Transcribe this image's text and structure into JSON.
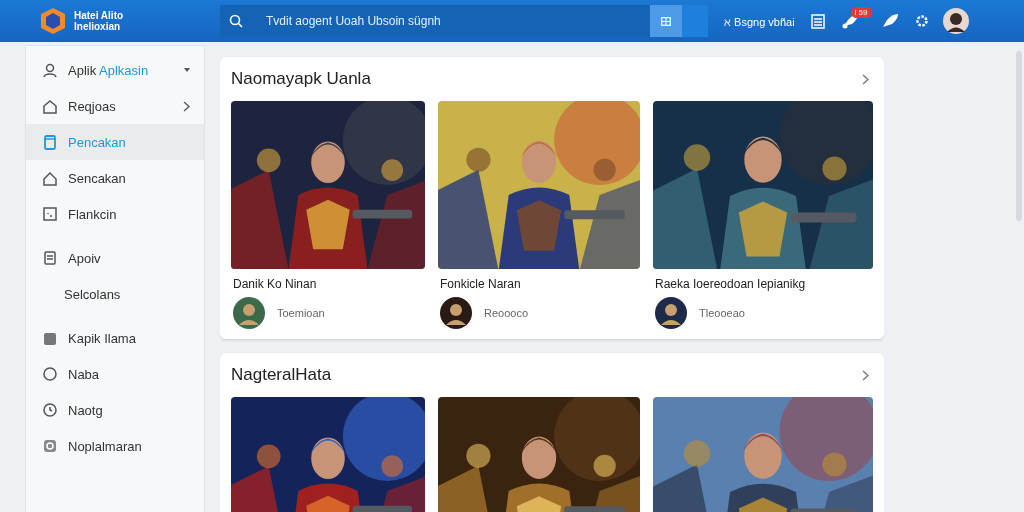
{
  "topbar": {
    "brand": [
      "Hatei Alito",
      "Inelioxian"
    ],
    "search": {
      "placeholder": "Tvdit aogent Uoah Ubsoin sügnh"
    },
    "account_label": "ℵ Bsgng vbñai",
    "badge": "i 59"
  },
  "sidebar": {
    "items": [
      {
        "kind": "header",
        "label": "Aplik",
        "accent": "Aplkasin",
        "selected": false
      },
      {
        "kind": "group",
        "label": "Reqjoas",
        "selected": false
      },
      {
        "kind": "link",
        "label": "Pencakan",
        "selected": true
      },
      {
        "kind": "link",
        "label": "Sencakan",
        "selected": false
      },
      {
        "kind": "link",
        "label": "Flankcin",
        "selected": false
      },
      {
        "kind": "link",
        "label": "Apoiv",
        "selected": false
      },
      {
        "kind": "sub",
        "label": "Selcolans",
        "selected": false
      },
      {
        "kind": "link",
        "label": "Kapik Ilama",
        "selected": false
      },
      {
        "kind": "link",
        "label": "Naba",
        "selected": false
      },
      {
        "kind": "link",
        "label": "Naotg",
        "selected": false
      },
      {
        "kind": "link",
        "label": "Noplalmaran",
        "selected": false
      }
    ]
  },
  "sections": [
    {
      "title": "Naomayapk Uanla",
      "cards": [
        {
          "kind": "game",
          "title": "Danik Ko Ninan",
          "subtitle": "Toemioan"
        },
        {
          "kind": "game",
          "title": "Fonkicle Naran",
          "subtitle": "Reoooco"
        },
        {
          "kind": "game",
          "title": "Raeka Ioereodoan Iepianikg",
          "subtitle": "Tleooeao"
        }
      ]
    },
    {
      "title": "NagteralHata"
    }
  ]
}
